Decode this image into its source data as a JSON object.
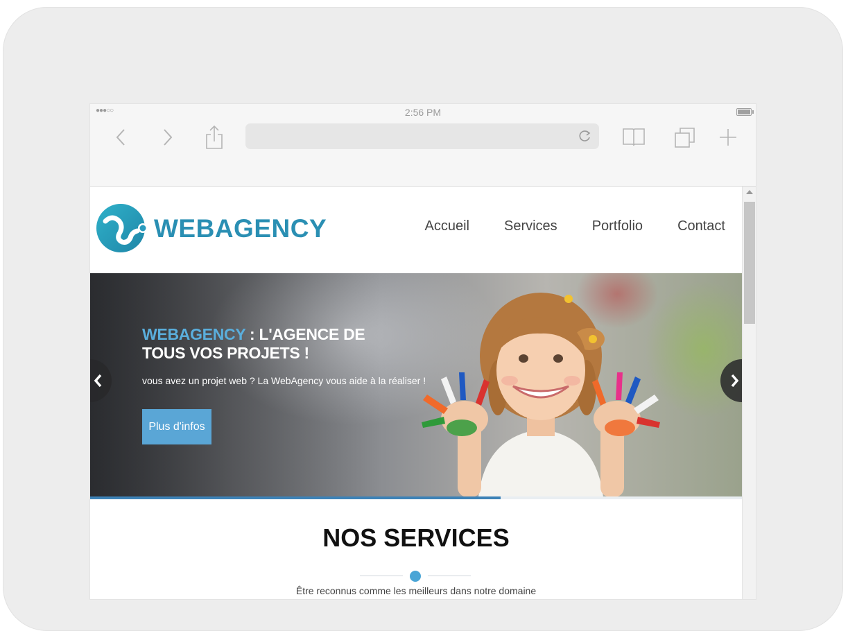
{
  "status_bar": {
    "signal": "●●●○○",
    "time": "2:56 PM"
  },
  "brand": {
    "name": "WEBAGENCY",
    "color": "#2a8fb3"
  },
  "nav": {
    "items": [
      "Accueil",
      "Services",
      "Portfolio",
      "Contact"
    ]
  },
  "hero": {
    "title_accent": "WEBAGENCY",
    "title_rest": " : L'AGENCE DE TOUS VOS PROJETS !",
    "subtitle": "vous avez un projet web ? La WebAgency vous aide à la réaliser !",
    "button_label": "Plus d'infos",
    "accent_color": "#5aaedc",
    "slide_progress": 0.63
  },
  "services": {
    "title": "NOS SERVICES",
    "subtitle": "Être reconnus comme les meilleurs dans notre domaine"
  },
  "icons": [
    "back-icon",
    "forward-icon",
    "share-icon",
    "reload-icon",
    "bookmarks-icon",
    "tabs-icon",
    "new-tab-icon",
    "prev-slide-icon",
    "next-slide-icon"
  ]
}
